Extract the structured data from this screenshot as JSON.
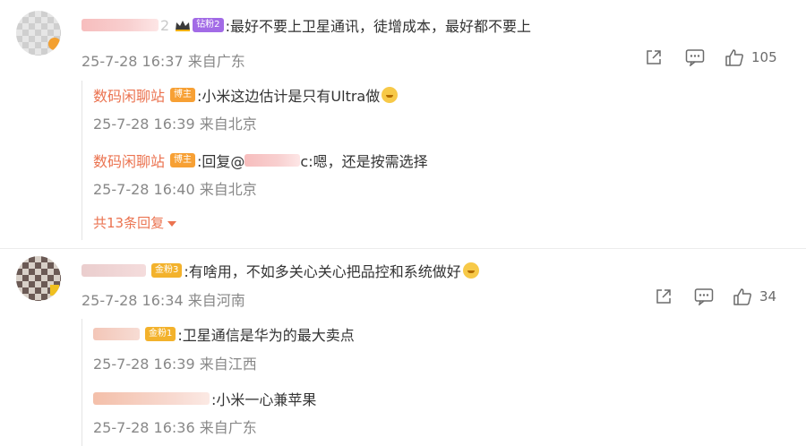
{
  "comments": [
    {
      "text": ":最好不要上卫星通讯，徒增成本，最好都不要上",
      "username_visible": "2",
      "badge": "钻粉2",
      "meta": "25-7-28 16:37 来自广东",
      "likes": "105",
      "replies": [
        {
          "user": "数码闲聊站",
          "badge": "博主",
          "text": ":小米这边估计是只有Ultra做",
          "meta": "25-7-28 16:39 来自北京"
        },
        {
          "user": "数码闲聊站",
          "badge": "博主",
          "text_prefix": ":回复@",
          "text": "c:嗯，还是按需选择",
          "meta": "25-7-28 16:40 来自北京"
        }
      ],
      "more_replies": "共13条回复"
    },
    {
      "text": ":有啥用，不如多关心关心把品控和系统做好",
      "badge": "金粉3",
      "meta": "25-7-28 16:34 来自河南",
      "likes": "34",
      "replies": [
        {
          "user": "",
          "badge": "金粉1",
          "text": ":卫星通信是华为的最大卖点",
          "meta": "25-7-28 16:39 来自江西"
        },
        {
          "user": "",
          "text": ":小米一心兼苹果",
          "meta": "25-7-28 16:36 来自广东"
        }
      ]
    }
  ],
  "colors": {
    "accent": "#eb7350",
    "meta": "#888888"
  },
  "icons": [
    "share-icon",
    "comment-icon",
    "like-icon",
    "crown-icon"
  ]
}
